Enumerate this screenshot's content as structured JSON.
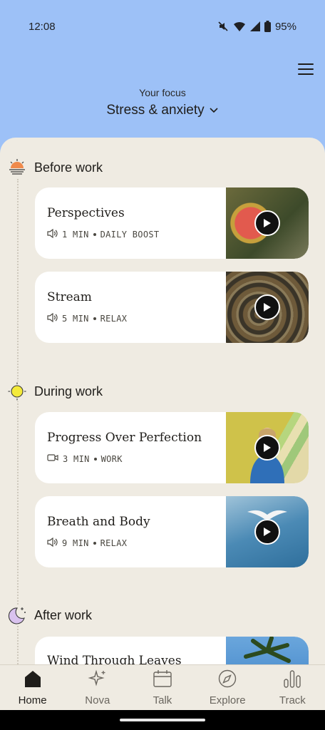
{
  "status": {
    "time": "12:08",
    "battery": "95%"
  },
  "header": {
    "focus_label": "Your focus",
    "focus_value": "Stress & anxiety"
  },
  "sections": [
    {
      "title": "Before work",
      "icon": "sunrise-icon"
    },
    {
      "title": "During work",
      "icon": "sun-icon"
    },
    {
      "title": "After work",
      "icon": "moon-icon"
    }
  ],
  "cards": [
    {
      "title": "Perspectives",
      "media": "audio",
      "duration": "1 MIN",
      "category": "DAILY BOOST"
    },
    {
      "title": "Stream",
      "media": "audio",
      "duration": "5 MIN",
      "category": "RELAX"
    },
    {
      "title": "Progress Over Perfection",
      "media": "video",
      "duration": "3 MIN",
      "category": "WORK"
    },
    {
      "title": "Breath and Body",
      "media": "audio",
      "duration": "9 MIN",
      "category": "RELAX"
    },
    {
      "title": "Wind Through Leaves"
    }
  ],
  "nav": [
    {
      "label": "Home",
      "icon": "home-icon",
      "active": true
    },
    {
      "label": "Nova",
      "icon": "sparkle-icon"
    },
    {
      "label": "Talk",
      "icon": "calendar-icon"
    },
    {
      "label": "Explore",
      "icon": "compass-icon"
    },
    {
      "label": "Track",
      "icon": "bar-chart-icon"
    }
  ],
  "colors": {
    "header_bg": "#9dc1f7",
    "sheet_bg": "#efebe2",
    "card_bg": "#ffffff",
    "sunrise": "#f08a4b",
    "sun": "#f4ea3a",
    "moon": "#d9c2ee"
  }
}
